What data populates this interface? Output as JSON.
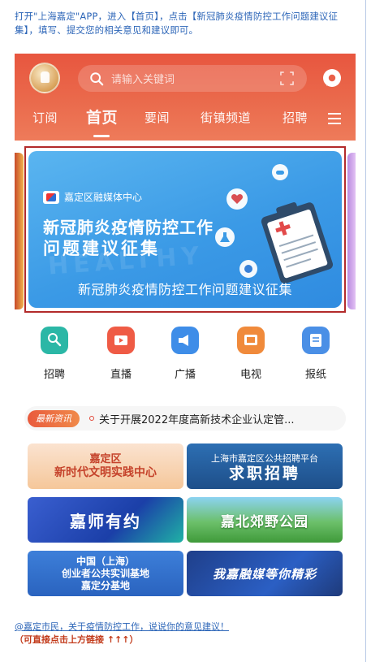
{
  "intro_text": "打开\"上海嘉定\"APP，进入【首页】，点击【新冠肺炎疫情防控工作问题建议征集】，填写、提交您的相关意见和建议即可。",
  "search": {
    "placeholder": "请输入关键词"
  },
  "tabs": [
    {
      "label": "订阅"
    },
    {
      "label": "首页"
    },
    {
      "label": "要闻"
    },
    {
      "label": "街镇频道"
    },
    {
      "label": "招聘"
    }
  ],
  "banner": {
    "brand": "嘉定区融媒体中心",
    "title_line1": "新冠肺炎疫情防控工作",
    "title_line2": "问题建议征集",
    "watermark": "HEALTHY",
    "subtitle": "新冠肺炎疫情防控工作问题建议征集"
  },
  "quick_icons": [
    {
      "label": "招聘",
      "icon": "recruit-icon",
      "color": "#2bb7a6"
    },
    {
      "label": "直播",
      "icon": "live-icon",
      "color": "#ef5b45"
    },
    {
      "label": "广播",
      "icon": "broadcast-icon",
      "color": "#3e8de8"
    },
    {
      "label": "电视",
      "icon": "tv-icon",
      "color": "#f08a3b"
    },
    {
      "label": "报纸",
      "icon": "newspaper-icon",
      "color": "#4a8fe6"
    }
  ],
  "news": {
    "tag": "最新资讯",
    "headline": "关于开展2022年度高新技术企业认定管..."
  },
  "cards": [
    {
      "line1": "嘉定区",
      "line2": "新时代文明实践中心"
    },
    {
      "line1": "上海市嘉定区公共招聘平台",
      "line2": "求职招聘"
    },
    {
      "line1": "嘉师有约",
      "line2": ""
    },
    {
      "line1": "嘉北郊野公园",
      "line2": ""
    },
    {
      "line1": "中国（上海）",
      "line2": "创业者公共实训基地",
      "line3": "嘉定分基地"
    },
    {
      "line1": "我嘉融媒等你精彩",
      "line2": ""
    }
  ],
  "footer": {
    "link_text": "@嘉定市民，关于疫情防控工作，说说你的意见建议！",
    "hint_text": "（可直接点击上方链接 ↑↑↑）"
  },
  "colors": {
    "header_red": "#e8563f",
    "link_blue": "#2d66b8",
    "hint_red": "#c23a1a",
    "frame_red": "#b32b2b"
  }
}
